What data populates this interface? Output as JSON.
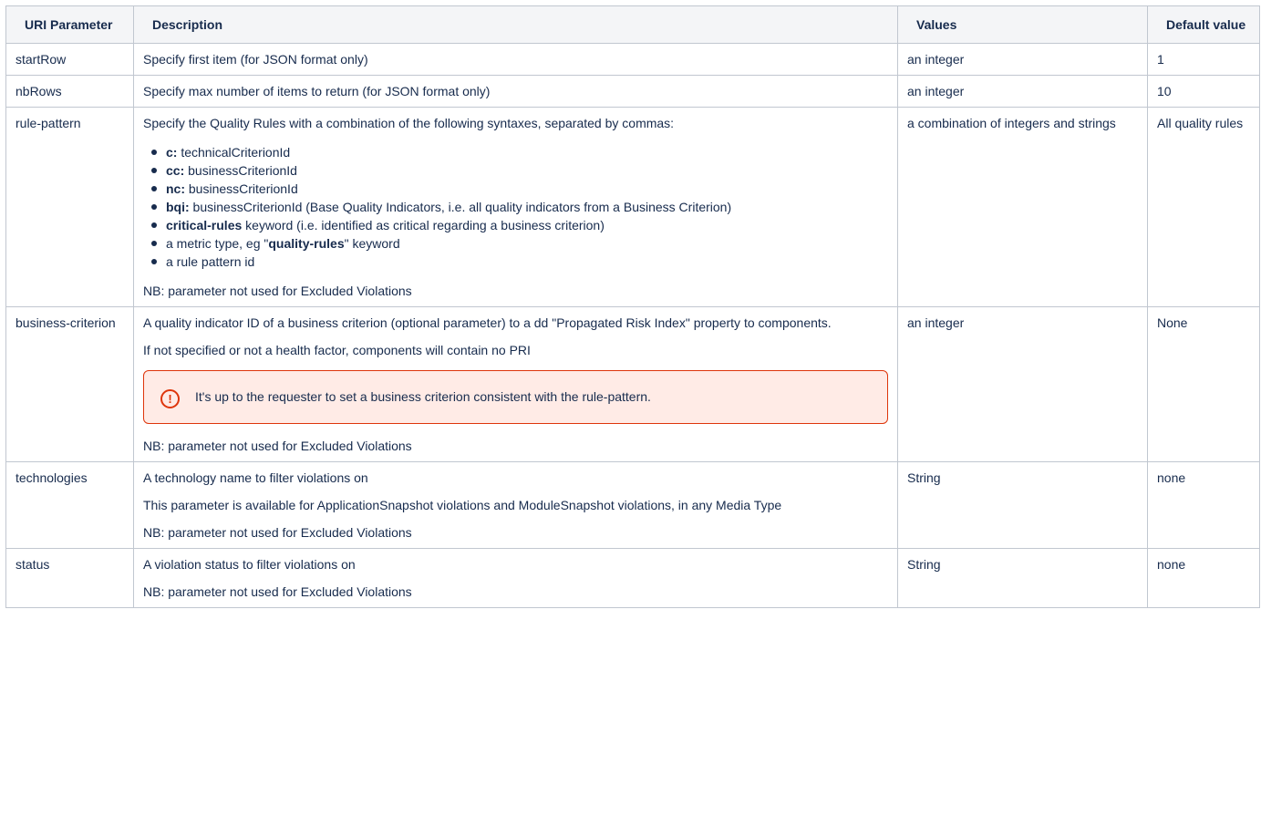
{
  "headers": {
    "param": "URI Parameter",
    "description": "Description",
    "values": "Values",
    "default": "Default value"
  },
  "rows": {
    "startRow": {
      "param": "startRow",
      "description": "Specify first item (for JSON format only)",
      "values": "an integer",
      "default": "1"
    },
    "nbRows": {
      "param": "nbRows",
      "description": "Specify max number of items to return (for JSON format only)",
      "values": "an integer",
      "default": "10"
    },
    "rulePattern": {
      "param": "rule-pattern",
      "intro": "Specify the Quality Rules with a combination of the following syntaxes, separated by commas:",
      "bullets": [
        {
          "bold": "c:",
          "text": " technicalCriterionId"
        },
        {
          "bold": "cc:",
          "text": " businessCriterionId"
        },
        {
          "bold": "nc:",
          "text": " businessCriterionId"
        },
        {
          "bold": "bqi:",
          "text": " businessCriterionId (Base Quality Indicators, i.e. all quality indicators from a Business Criterion)"
        },
        {
          "bold": "critical-rules",
          "text": " keyword (i.e. identified as critical regarding a business criterion)"
        },
        {
          "pre": "a metric type, eg \"",
          "bold": "quality-rules",
          "text": "\" keyword"
        },
        {
          "text": "a rule pattern id"
        }
      ],
      "note": "NB: parameter not used for Excluded Violations",
      "values": "a combination of integers and strings",
      "default": "All quality rules"
    },
    "businessCriterion": {
      "param": "business-criterion",
      "p1": "A quality indicator ID of a business criterion (optional parameter) to a dd \"Propagated Risk Index\" property to components.",
      "p2": "If not specified or not a health factor, components will contain no PRI",
      "warning": "It's up to the requester to set a business criterion consistent with the rule-pattern.",
      "warning_icon": "!",
      "note": "NB: parameter not used for Excluded Violations",
      "values": "an integer",
      "default": "None"
    },
    "technologies": {
      "param": "technologies",
      "p1": "A technology name to filter violations on",
      "p2": "This parameter is available for ApplicationSnapshot violations and ModuleSnapshot violations, in any Media Type",
      "note": "NB: parameter not used for Excluded Violations",
      "values": "String",
      "default": "none"
    },
    "status": {
      "param": "status",
      "p1": "A violation status to filter violations on",
      "note": "NB: parameter not used for Excluded Violations",
      "values": "String",
      "default": "none"
    }
  },
  "colors": {
    "border": "#c1c7d0",
    "header_bg": "#f4f5f7",
    "text": "#172b4d",
    "warning_border": "#de350b",
    "warning_bg": "#ffebe6"
  }
}
